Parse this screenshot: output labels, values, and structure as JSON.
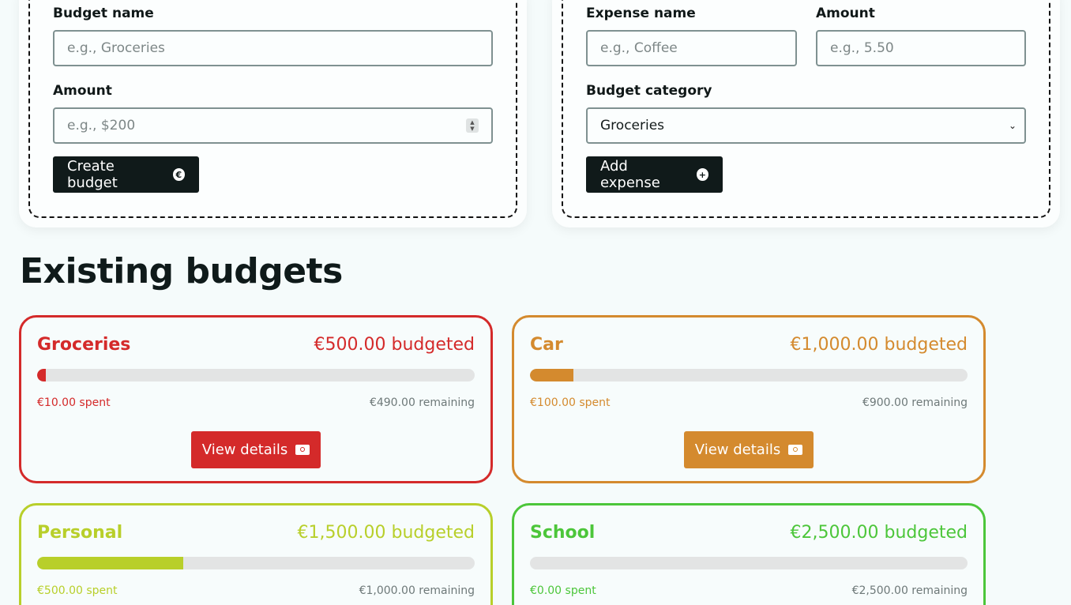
{
  "budget_form": {
    "name_label": "Budget name",
    "name_placeholder": "e.g., Groceries",
    "amount_label": "Amount",
    "amount_placeholder": "e.g., $200",
    "submit_label": "Create budget",
    "submit_icon": "euro-circle-icon"
  },
  "expense_form": {
    "name_label": "Expense name",
    "name_placeholder": "e.g., Coffee",
    "amount_label": "Amount",
    "amount_placeholder": "e.g., 5.50",
    "category_label": "Budget category",
    "category_selected": "Groceries",
    "submit_label": "Add expense",
    "submit_icon": "plus-circle-icon"
  },
  "existing": {
    "heading": "Existing budgets",
    "view_label": "View details",
    "budgets": [
      {
        "name": "Groceries",
        "budgeted": "€500.00 budgeted",
        "spent": "€10.00 spent",
        "remaining": "€490.00 remaining",
        "progress": 0.02,
        "color": "#d42a2a"
      },
      {
        "name": "Car",
        "budgeted": "€1,000.00 budgeted",
        "spent": "€100.00 spent",
        "remaining": "€900.00 remaining",
        "progress": 0.1,
        "color": "#d48a2e"
      },
      {
        "name": "Personal",
        "budgeted": "€1,500.00 budgeted",
        "spent": "€500.00 spent",
        "remaining": "€1,000.00 remaining",
        "progress": 0.3333,
        "color": "#b8cf2a"
      },
      {
        "name": "School",
        "budgeted": "€2,500.00 budgeted",
        "spent": "€0.00 spent",
        "remaining": "€2,500.00 remaining",
        "progress": 0.0,
        "color": "#4cc63a"
      }
    ]
  }
}
